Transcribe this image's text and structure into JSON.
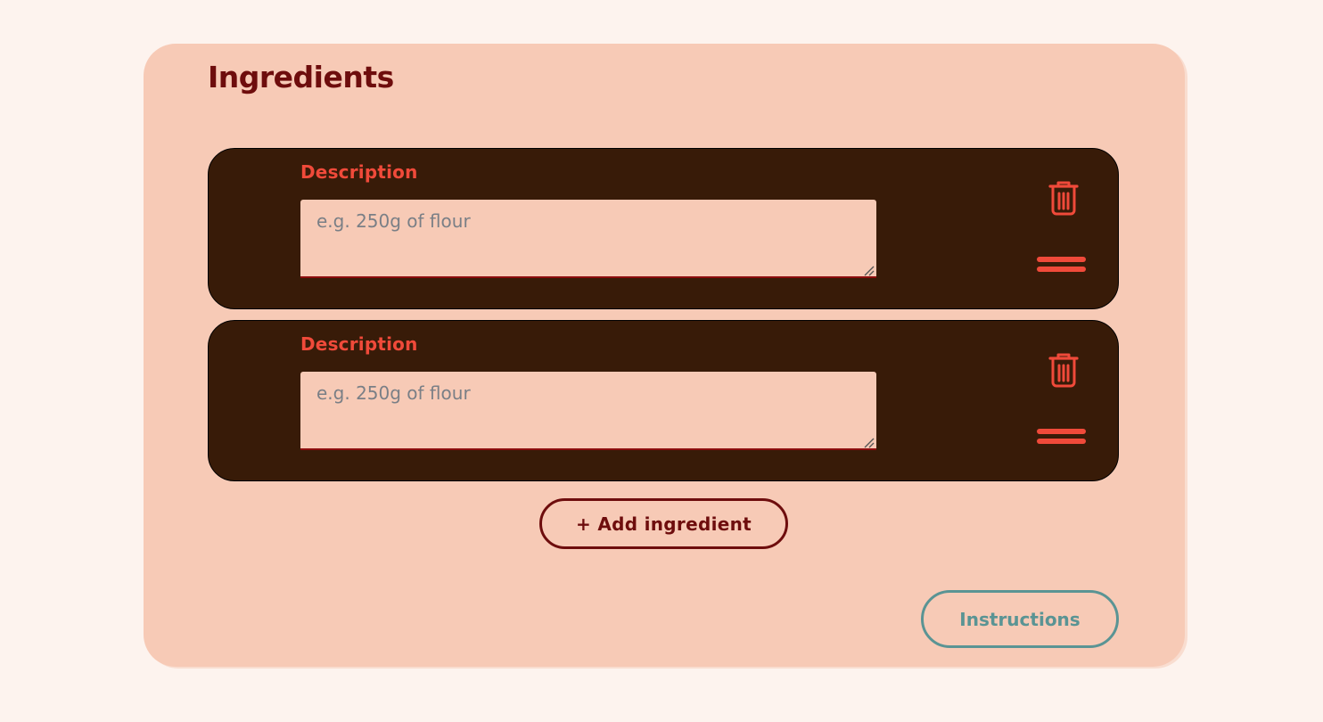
{
  "section": {
    "title": "Ingredients"
  },
  "ingredients": [
    {
      "label": "Description",
      "value": "",
      "placeholder": "e.g. 250g of flour"
    },
    {
      "label": "Description",
      "value": "",
      "placeholder": "e.g. 250g of flour"
    }
  ],
  "actions": {
    "add_label": "+ Add ingredient",
    "next_label": "Instructions"
  },
  "icons": {
    "delete": "trash-icon",
    "drag": "drag-handle-icon"
  },
  "colors": {
    "page_background": "#fdf3ee",
    "card_background": "#f7cab6",
    "row_background": "#381b08",
    "accent": "#f04a3a",
    "title": "#6e0d0d",
    "secondary_button": "#5a9494"
  }
}
